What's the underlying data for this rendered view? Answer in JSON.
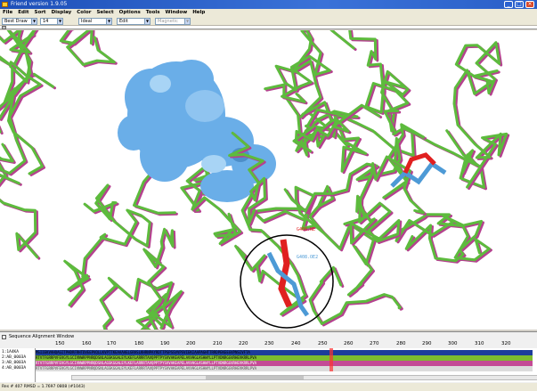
{
  "window": {
    "title": "Friend version 1.9.05"
  },
  "menu": [
    "File",
    "Edit",
    "Sort",
    "Display",
    "Color",
    "Select",
    "Options",
    "Tools",
    "Window",
    "Help"
  ],
  "toolbar": {
    "style": "Best Draw",
    "size": "14",
    "mode": "Ideal",
    "edit": "Edit",
    "search_placeholder": "Magnetic"
  },
  "viewport": {
    "label_red": "G408.NE",
    "label_blue": "G408.OE2",
    "colors": {
      "green": "#5dbb3d",
      "magenta": "#b5418f",
      "ligand": "#6aaee8",
      "red": "#e02020",
      "blue": "#4d9ad6"
    }
  },
  "sequence_window": {
    "title": "Sequence Alignment Window",
    "ruler": [
      "150",
      "160",
      "170",
      "180",
      "190",
      "200",
      "210",
      "220",
      "230",
      "240",
      "250",
      "260",
      "270",
      "280",
      "290",
      "300",
      "310",
      "320"
    ],
    "names": [
      "1:1A4KA",
      "2:AB_0003A",
      "3:AB_0003A",
      "4:AB_0003A"
    ],
    "rows": [
      "MSIIEKVAHQAGITPHDRFRHTDVEEPVQLLKVPTTKEAAAAELGRASLKHRNPAYRDTTPSPSSVVPSVIEKIAAPAGHTTRRDPEKEEGVPNSIVFTA",
      "RTVTFGRRPVFEVGYLGCIVNWRPPNRQDSNLAGSKGGALEYLKEFLARRRTAVQPPTPYSVVAKEAPELAVVHGLASHWYLLPTVDNRGGVRHEVKRRLPVA",
      "RTVTFGRRPVFEVGYLGCIVNWRPPNRQDSNLAGSKGGALEYLKEFLARRRTAVQPPTPYSVVAKEAPELAVVHGLASHWYLLPTVDNRGGVRHEVKRRLPVA",
      "RTVTFGRRPVFEVGYLGCIVNWRPPNRQDSNLAGSKGGALEYLKEFLARRRTAVQPPTPYSVVAKEAPELAVVHGLASHWYLLPTVDNRGGVRHEVKRRLPVA"
    ]
  },
  "status": {
    "text": "Res # 407 RMSD = 1.7697 0808 (#1043)"
  }
}
